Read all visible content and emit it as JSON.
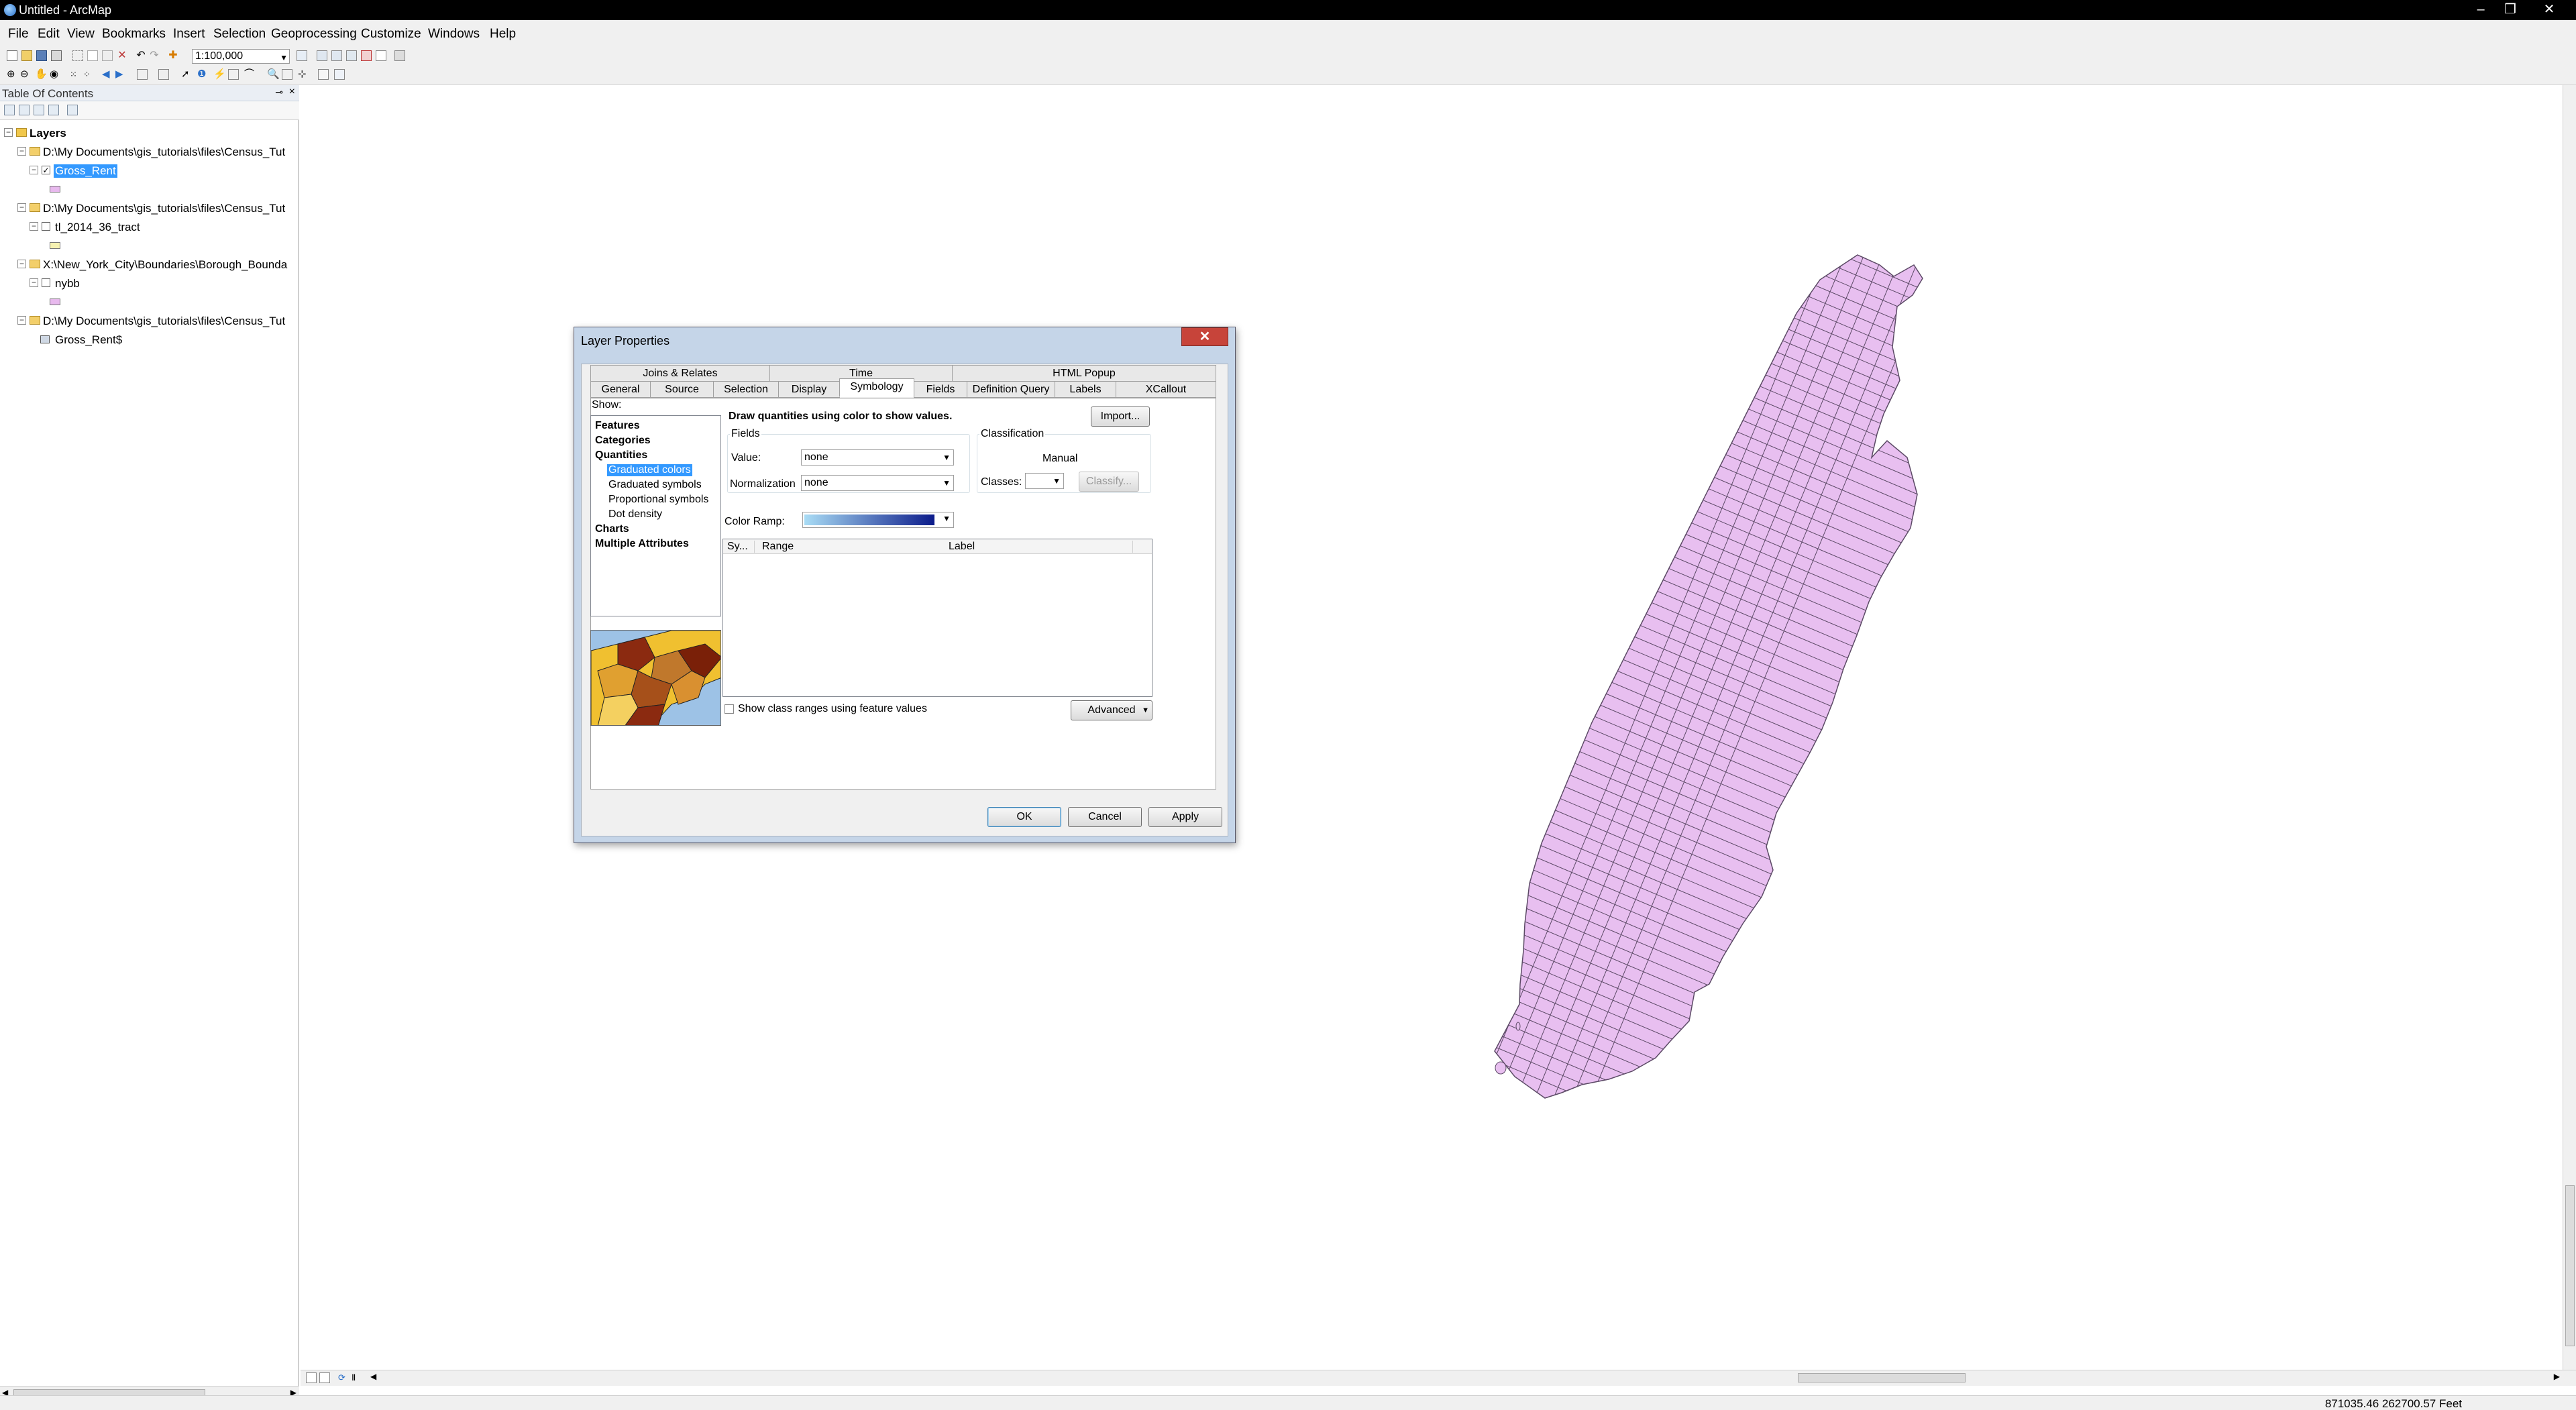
{
  "window": {
    "title": "Untitled - ArcMap",
    "minimize": "–",
    "restore": "❐",
    "close": "✕"
  },
  "menu": [
    "File",
    "Edit",
    "View",
    "Bookmarks",
    "Insert",
    "Selection",
    "Geoprocessing",
    "Customize",
    "Windows",
    "Help"
  ],
  "toolbar": {
    "scale": "1:100,000"
  },
  "toc": {
    "title": "Table Of Contents",
    "pin_icon": "pin-icon",
    "close_icon": "close-icon",
    "root": "Layers",
    "groups": [
      {
        "path": "D:\\My Documents\\gis_tutorials\\files\\Census_Tut",
        "layer": "Gross_Rent",
        "checked": true,
        "selected": true,
        "symbol_color": "#e8b9ee"
      },
      {
        "path": "D:\\My Documents\\gis_tutorials\\files\\Census_Tut",
        "layer": "tl_2014_36_tract",
        "checked": false,
        "selected": false,
        "symbol_color": "#f6f2b2"
      },
      {
        "path": "X:\\New_York_City\\Boundaries\\Borough_Bounda",
        "layer": "nybb",
        "checked": false,
        "selected": false,
        "symbol_color": "#e8b9ee"
      },
      {
        "path": "D:\\My Documents\\gis_tutorials\\files\\Census_Tut",
        "layer": "Gross_Rent$",
        "checked": null,
        "selected": false,
        "symbol_color": null
      }
    ]
  },
  "map": {
    "polygon_fill": "#e8bff0",
    "polygon_stroke": "#5c4a66"
  },
  "status": {
    "coordinates": "871035.46  262700.57 Feet"
  },
  "dialog": {
    "title": "Layer Properties",
    "close": "✕",
    "tabs_row1": [
      "Joins & Relates",
      "Time",
      "HTML Popup"
    ],
    "tabs_row2": [
      "General",
      "Source",
      "Selection",
      "Display",
      "Symbology",
      "Fields",
      "Definition Query",
      "Labels",
      "XCallout"
    ],
    "active_tab": "Symbology",
    "show_label": "Show:",
    "show_items": [
      {
        "label": "Features",
        "bold": true,
        "sub": false
      },
      {
        "label": "Categories",
        "bold": true,
        "sub": false
      },
      {
        "label": "Quantities",
        "bold": true,
        "sub": false
      },
      {
        "label": "Graduated colors",
        "bold": false,
        "sub": true,
        "selected": true
      },
      {
        "label": "Graduated symbols",
        "bold": false,
        "sub": true
      },
      {
        "label": "Proportional symbols",
        "bold": false,
        "sub": true
      },
      {
        "label": "Dot density",
        "bold": false,
        "sub": true
      },
      {
        "label": "Charts",
        "bold": true,
        "sub": false
      },
      {
        "label": "Multiple Attributes",
        "bold": true,
        "sub": false
      }
    ],
    "description": "Draw quantities using color to show values.",
    "import_button": "Import...",
    "fields_label": "Fields",
    "value_label": "Value:",
    "value_selected": "none",
    "normalization_label": "Normalization",
    "normalization_selected": "none",
    "classification_label": "Classification",
    "classification_method": "Manual",
    "classes_label": "Classes:",
    "classes_value": "",
    "classify_button": "Classify...",
    "color_ramp_label": "Color Ramp:",
    "color_ramp_from": "#a9dcf5",
    "color_ramp_to": "#0b1b8a",
    "grid_columns": [
      "Sy...",
      "Range",
      "Label"
    ],
    "show_class_ranges": "Show class ranges using feature values",
    "advanced_button": "Advanced",
    "ok": "OK",
    "cancel": "Cancel",
    "apply": "Apply"
  }
}
